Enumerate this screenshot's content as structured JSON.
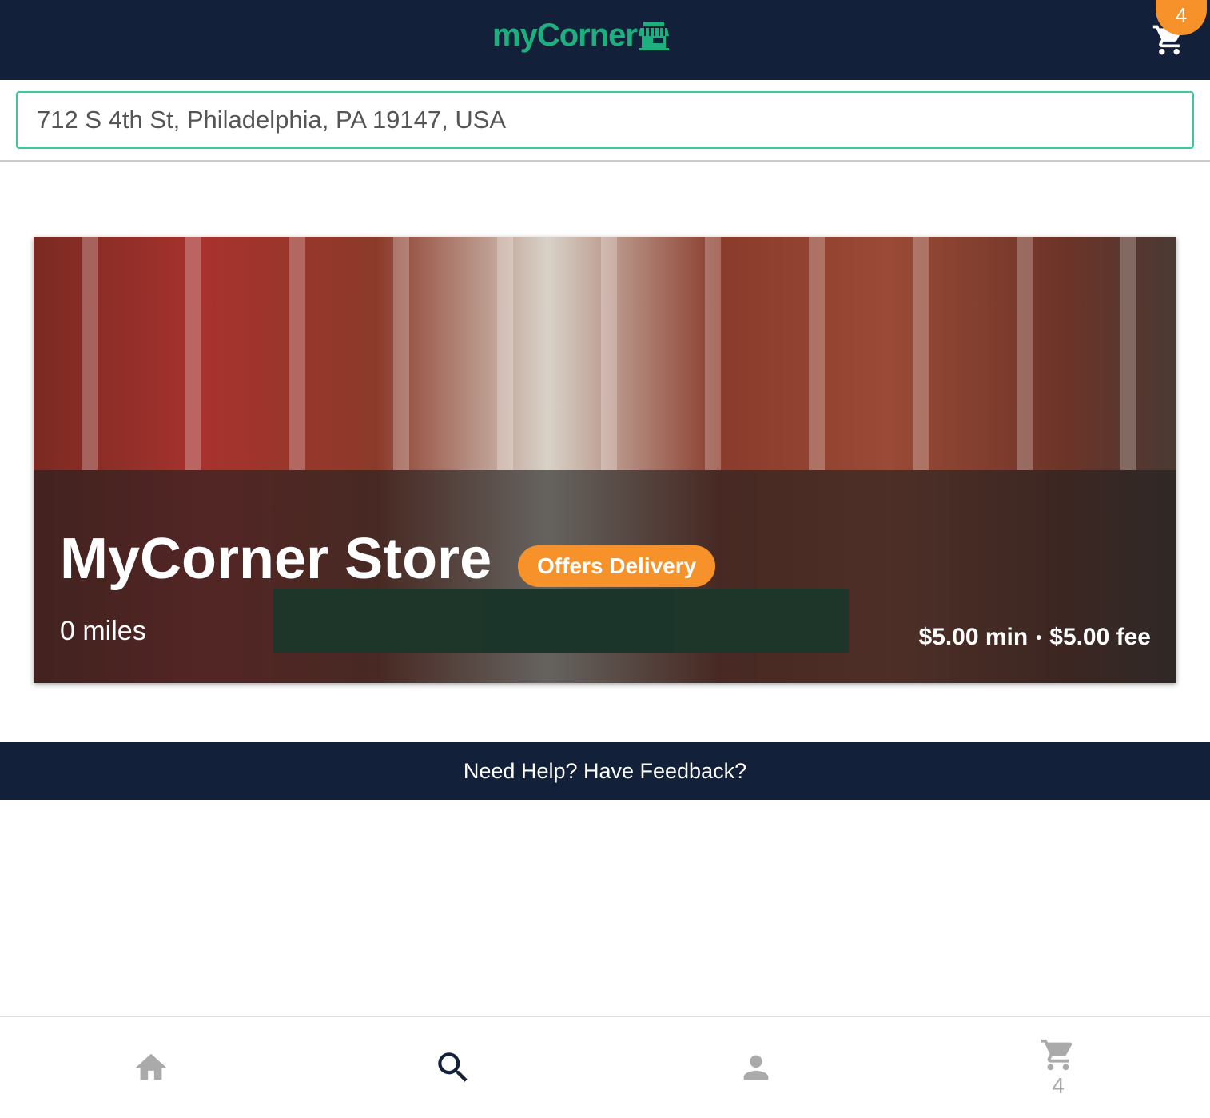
{
  "header": {
    "logo_text": "myCorner",
    "cart_count": "4"
  },
  "search": {
    "value": "712 S 4th St, Philadelphia, PA 19147, USA"
  },
  "store": {
    "name": "MyCorner Store",
    "badge": "Offers Delivery",
    "distance": "0 miles",
    "minimum": "$5.00 min",
    "separator": "•",
    "fee": "$5.00 fee"
  },
  "help": {
    "label": "Need Help? Have Feedback?"
  },
  "bottom_nav": {
    "cart_count": "4"
  },
  "colors": {
    "navy": "#12203a",
    "green": "#1db07e",
    "orange": "#f7922a"
  }
}
